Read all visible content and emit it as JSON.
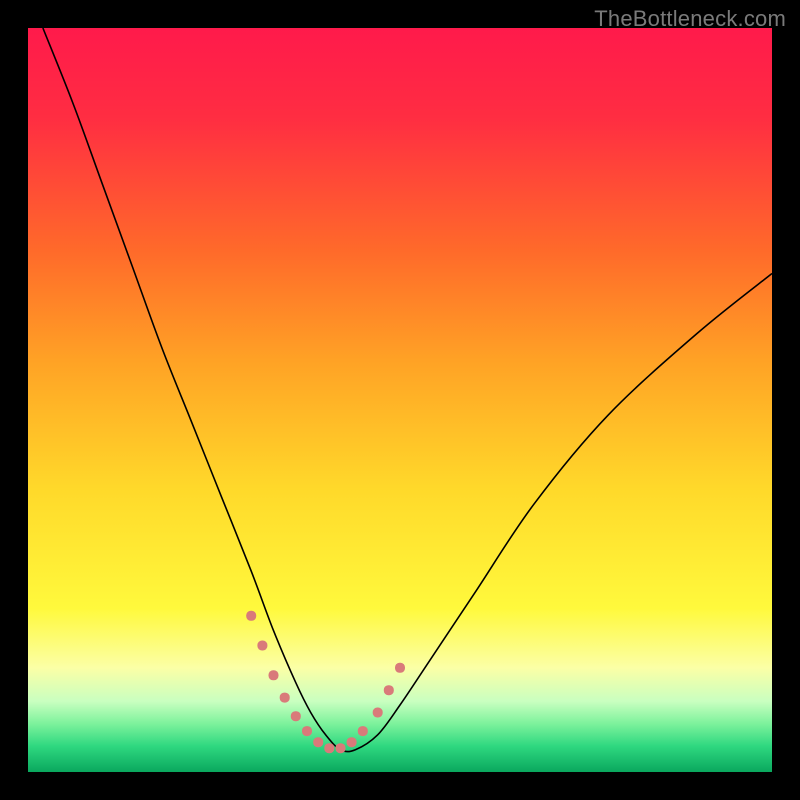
{
  "watermark": {
    "text": "TheBottleneck.com"
  },
  "chart_data": {
    "type": "line",
    "title": "",
    "xlabel": "",
    "ylabel": "",
    "xlim": [
      0,
      100
    ],
    "ylim": [
      0,
      100
    ],
    "grid": false,
    "background_gradient": {
      "stops": [
        {
          "offset": 0.0,
          "color": "#ff1a4b"
        },
        {
          "offset": 0.12,
          "color": "#ff2d42"
        },
        {
          "offset": 0.3,
          "color": "#ff6a2a"
        },
        {
          "offset": 0.45,
          "color": "#ffa325"
        },
        {
          "offset": 0.62,
          "color": "#ffd92a"
        },
        {
          "offset": 0.78,
          "color": "#fff93c"
        },
        {
          "offset": 0.86,
          "color": "#fbffa6"
        },
        {
          "offset": 0.905,
          "color": "#c9ffc0"
        },
        {
          "offset": 0.935,
          "color": "#7df29c"
        },
        {
          "offset": 0.965,
          "color": "#2fd880"
        },
        {
          "offset": 1.0,
          "color": "#0aa85e"
        }
      ]
    },
    "series": [
      {
        "name": "bottleneck-curve",
        "type": "line",
        "color": "#000000",
        "stroke_width": 1.6,
        "x": [
          2,
          6,
          10,
          14,
          18,
          22,
          26,
          30,
          33,
          36,
          38,
          40,
          42,
          44,
          47,
          50,
          54,
          60,
          68,
          78,
          90,
          100
        ],
        "y": [
          100,
          90,
          79,
          68,
          57,
          47,
          37,
          27,
          19,
          12,
          8,
          5,
          3,
          3,
          5,
          9,
          15,
          24,
          36,
          48,
          59,
          67
        ]
      },
      {
        "name": "bottleneck-band-markers",
        "type": "scatter",
        "color": "#d97a7a",
        "marker_size": 10,
        "x": [
          30.0,
          31.5,
          33.0,
          34.5,
          36.0,
          37.5,
          39.0,
          40.5,
          42.0,
          43.5,
          45.0,
          47.0,
          48.5,
          50.0
        ],
        "y": [
          21.0,
          17.0,
          13.0,
          10.0,
          7.5,
          5.5,
          4.0,
          3.2,
          3.2,
          4.0,
          5.5,
          8.0,
          11.0,
          14.0
        ]
      }
    ],
    "annotations": []
  }
}
